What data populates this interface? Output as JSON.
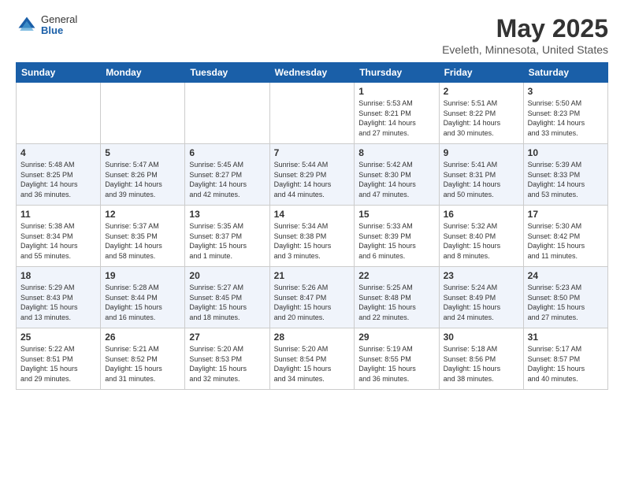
{
  "header": {
    "logo_general": "General",
    "logo_blue": "Blue",
    "title": "May 2025",
    "subtitle": "Eveleth, Minnesota, United States"
  },
  "weekdays": [
    "Sunday",
    "Monday",
    "Tuesday",
    "Wednesday",
    "Thursday",
    "Friday",
    "Saturday"
  ],
  "weeks": [
    [
      {
        "day": "",
        "info": ""
      },
      {
        "day": "",
        "info": ""
      },
      {
        "day": "",
        "info": ""
      },
      {
        "day": "",
        "info": ""
      },
      {
        "day": "1",
        "info": "Sunrise: 5:53 AM\nSunset: 8:21 PM\nDaylight: 14 hours\nand 27 minutes."
      },
      {
        "day": "2",
        "info": "Sunrise: 5:51 AM\nSunset: 8:22 PM\nDaylight: 14 hours\nand 30 minutes."
      },
      {
        "day": "3",
        "info": "Sunrise: 5:50 AM\nSunset: 8:23 PM\nDaylight: 14 hours\nand 33 minutes."
      }
    ],
    [
      {
        "day": "4",
        "info": "Sunrise: 5:48 AM\nSunset: 8:25 PM\nDaylight: 14 hours\nand 36 minutes."
      },
      {
        "day": "5",
        "info": "Sunrise: 5:47 AM\nSunset: 8:26 PM\nDaylight: 14 hours\nand 39 minutes."
      },
      {
        "day": "6",
        "info": "Sunrise: 5:45 AM\nSunset: 8:27 PM\nDaylight: 14 hours\nand 42 minutes."
      },
      {
        "day": "7",
        "info": "Sunrise: 5:44 AM\nSunset: 8:29 PM\nDaylight: 14 hours\nand 44 minutes."
      },
      {
        "day": "8",
        "info": "Sunrise: 5:42 AM\nSunset: 8:30 PM\nDaylight: 14 hours\nand 47 minutes."
      },
      {
        "day": "9",
        "info": "Sunrise: 5:41 AM\nSunset: 8:31 PM\nDaylight: 14 hours\nand 50 minutes."
      },
      {
        "day": "10",
        "info": "Sunrise: 5:39 AM\nSunset: 8:33 PM\nDaylight: 14 hours\nand 53 minutes."
      }
    ],
    [
      {
        "day": "11",
        "info": "Sunrise: 5:38 AM\nSunset: 8:34 PM\nDaylight: 14 hours\nand 55 minutes."
      },
      {
        "day": "12",
        "info": "Sunrise: 5:37 AM\nSunset: 8:35 PM\nDaylight: 14 hours\nand 58 minutes."
      },
      {
        "day": "13",
        "info": "Sunrise: 5:35 AM\nSunset: 8:37 PM\nDaylight: 15 hours\nand 1 minute."
      },
      {
        "day": "14",
        "info": "Sunrise: 5:34 AM\nSunset: 8:38 PM\nDaylight: 15 hours\nand 3 minutes."
      },
      {
        "day": "15",
        "info": "Sunrise: 5:33 AM\nSunset: 8:39 PM\nDaylight: 15 hours\nand 6 minutes."
      },
      {
        "day": "16",
        "info": "Sunrise: 5:32 AM\nSunset: 8:40 PM\nDaylight: 15 hours\nand 8 minutes."
      },
      {
        "day": "17",
        "info": "Sunrise: 5:30 AM\nSunset: 8:42 PM\nDaylight: 15 hours\nand 11 minutes."
      }
    ],
    [
      {
        "day": "18",
        "info": "Sunrise: 5:29 AM\nSunset: 8:43 PM\nDaylight: 15 hours\nand 13 minutes."
      },
      {
        "day": "19",
        "info": "Sunrise: 5:28 AM\nSunset: 8:44 PM\nDaylight: 15 hours\nand 16 minutes."
      },
      {
        "day": "20",
        "info": "Sunrise: 5:27 AM\nSunset: 8:45 PM\nDaylight: 15 hours\nand 18 minutes."
      },
      {
        "day": "21",
        "info": "Sunrise: 5:26 AM\nSunset: 8:47 PM\nDaylight: 15 hours\nand 20 minutes."
      },
      {
        "day": "22",
        "info": "Sunrise: 5:25 AM\nSunset: 8:48 PM\nDaylight: 15 hours\nand 22 minutes."
      },
      {
        "day": "23",
        "info": "Sunrise: 5:24 AM\nSunset: 8:49 PM\nDaylight: 15 hours\nand 24 minutes."
      },
      {
        "day": "24",
        "info": "Sunrise: 5:23 AM\nSunset: 8:50 PM\nDaylight: 15 hours\nand 27 minutes."
      }
    ],
    [
      {
        "day": "25",
        "info": "Sunrise: 5:22 AM\nSunset: 8:51 PM\nDaylight: 15 hours\nand 29 minutes."
      },
      {
        "day": "26",
        "info": "Sunrise: 5:21 AM\nSunset: 8:52 PM\nDaylight: 15 hours\nand 31 minutes."
      },
      {
        "day": "27",
        "info": "Sunrise: 5:20 AM\nSunset: 8:53 PM\nDaylight: 15 hours\nand 32 minutes."
      },
      {
        "day": "28",
        "info": "Sunrise: 5:20 AM\nSunset: 8:54 PM\nDaylight: 15 hours\nand 34 minutes."
      },
      {
        "day": "29",
        "info": "Sunrise: 5:19 AM\nSunset: 8:55 PM\nDaylight: 15 hours\nand 36 minutes."
      },
      {
        "day": "30",
        "info": "Sunrise: 5:18 AM\nSunset: 8:56 PM\nDaylight: 15 hours\nand 38 minutes."
      },
      {
        "day": "31",
        "info": "Sunrise: 5:17 AM\nSunset: 8:57 PM\nDaylight: 15 hours\nand 40 minutes."
      }
    ]
  ]
}
